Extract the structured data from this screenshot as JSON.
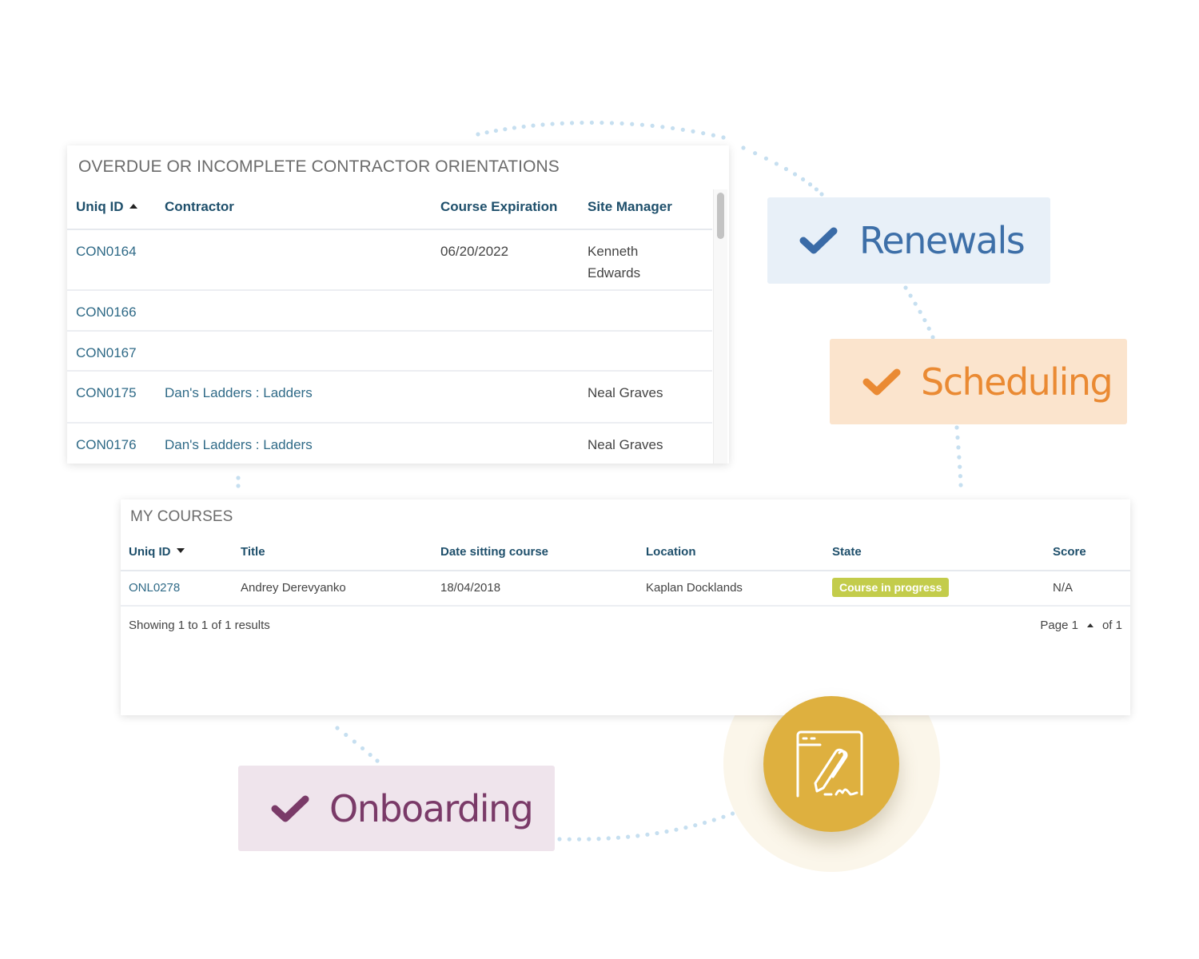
{
  "orientations": {
    "title": "OVERDUE OR INCOMPLETE CONTRACTOR ORIENTATIONS",
    "columns": [
      "Uniq ID",
      "Contractor",
      "Course Expiration",
      "Site Manager"
    ],
    "sort": {
      "column": "Uniq ID",
      "direction": "ascending"
    },
    "rows": [
      {
        "id": "CON0164",
        "contractor": "",
        "expiration": "06/20/2022",
        "manager": "Kenneth Edwards"
      },
      {
        "id": "CON0166",
        "contractor": "",
        "expiration": "",
        "manager": ""
      },
      {
        "id": "CON0167",
        "contractor": "",
        "expiration": "",
        "manager": ""
      },
      {
        "id": "CON0175",
        "contractor": "Dan's Ladders : Ladders",
        "expiration": "",
        "manager": "Neal Graves"
      },
      {
        "id": "CON0176",
        "contractor": "Dan's Ladders : Ladders",
        "expiration": "",
        "manager": "Neal Graves"
      }
    ]
  },
  "courses": {
    "title": "MY COURSES",
    "columns": [
      "Uniq ID",
      "Title",
      "Date sitting course",
      "Location",
      "State",
      "Score"
    ],
    "sort": {
      "column": "Uniq ID",
      "direction": "descending"
    },
    "rows": [
      {
        "id": "ONL0278",
        "title": "Andrey Derevyanko",
        "date": "18/04/2018",
        "location": "Kaplan Docklands",
        "state": "Course in progress",
        "score": "N/A"
      }
    ],
    "footer": {
      "results": "Showing 1 to 1 of 1 results",
      "page_label": "Page 1",
      "page_total": "of 1"
    }
  },
  "tags": {
    "renewals": {
      "label": "Renewals",
      "color": "#3d6fa8",
      "bg": "#e8f0f8"
    },
    "scheduling": {
      "label": "Scheduling",
      "color": "#ea8a33",
      "bg": "#fbe4cd"
    },
    "onboarding": {
      "label": "Onboarding",
      "color": "#7a3a68",
      "bg": "#efe4ec"
    }
  },
  "icon": {
    "name": "e-signature-icon",
    "color": "#deb03f"
  },
  "colors": {
    "link": "#2f6a87",
    "header": "#1e4f6b",
    "badge": "#c3cc4b",
    "dots": "#c6dff0"
  }
}
